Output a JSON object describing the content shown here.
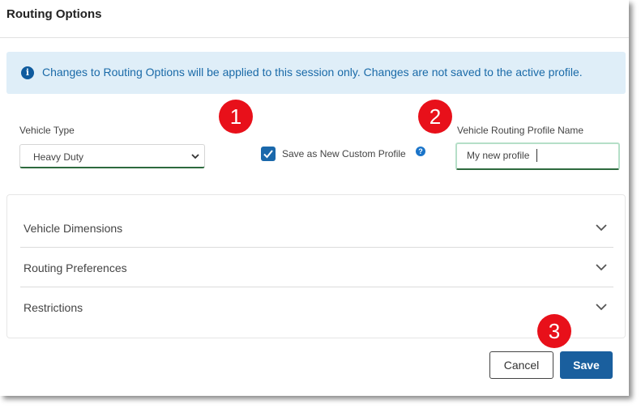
{
  "dialog": {
    "title": "Routing Options"
  },
  "info_banner": {
    "icon": "info-icon",
    "text": "Changes to Routing Options will be applied to this session only. Changes are not saved to the active profile."
  },
  "vehicle_type": {
    "label": "Vehicle Type",
    "selected": "Heavy Duty"
  },
  "save_custom": {
    "label": "Save as New Custom Profile",
    "checked": true
  },
  "profile_name": {
    "label": "Vehicle Routing Profile Name",
    "value": "My new profile"
  },
  "markers": [
    "1",
    "2",
    "3"
  ],
  "sections": [
    {
      "label": "Vehicle Dimensions"
    },
    {
      "label": "Routing Preferences"
    },
    {
      "label": "Restrictions"
    }
  ],
  "footer": {
    "cancel_label": "Cancel",
    "save_label": "Save"
  },
  "colors": {
    "accent": "#1a5f9e",
    "banner_bg": "#dfeef8",
    "banner_text": "#1a6aa8",
    "marker": "#e8101a",
    "input_focus": "#2d6a3e"
  }
}
